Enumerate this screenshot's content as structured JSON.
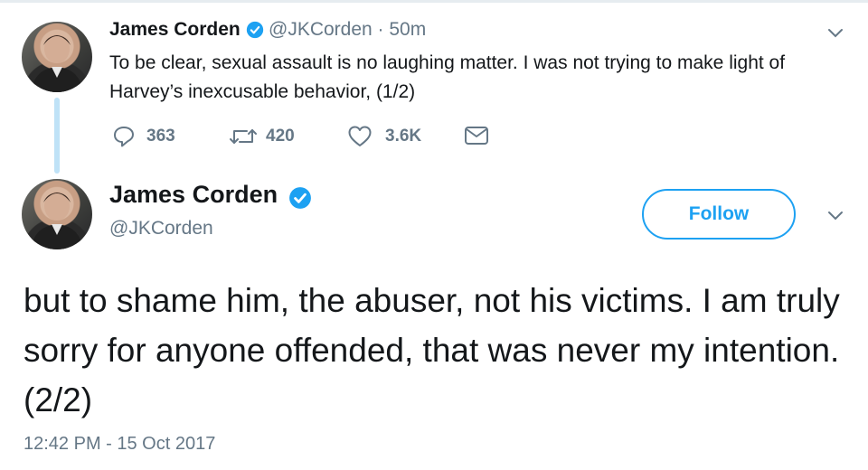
{
  "colors": {
    "accent": "#1da1f2",
    "secondary_text": "#657786",
    "primary_text": "#14171a",
    "thread_line": "#bfe2f7"
  },
  "tweet1": {
    "author_name": "James Corden",
    "handle_time": "@JKCorden · 50m",
    "text": "To be clear, sexual assault is no laughing matter. I was not trying to make light of Harvey’s inexcusable behavior, (1/2)",
    "actions": {
      "replies": "363",
      "retweets": "420",
      "likes": "3.6K"
    },
    "icons": [
      "reply-icon",
      "retweet-icon",
      "like-icon",
      "message-icon",
      "chevron-down-icon",
      "verified-badge-icon"
    ]
  },
  "tweet2": {
    "author_name": "James Corden",
    "handle": "@JKCorden",
    "follow_label": "Follow",
    "text": "but to shame him, the abuser, not his victims. I am truly sorry for anyone offended, that was never my intention. (2/2)",
    "timestamp": "12:42 PM - 15 Oct 2017"
  }
}
